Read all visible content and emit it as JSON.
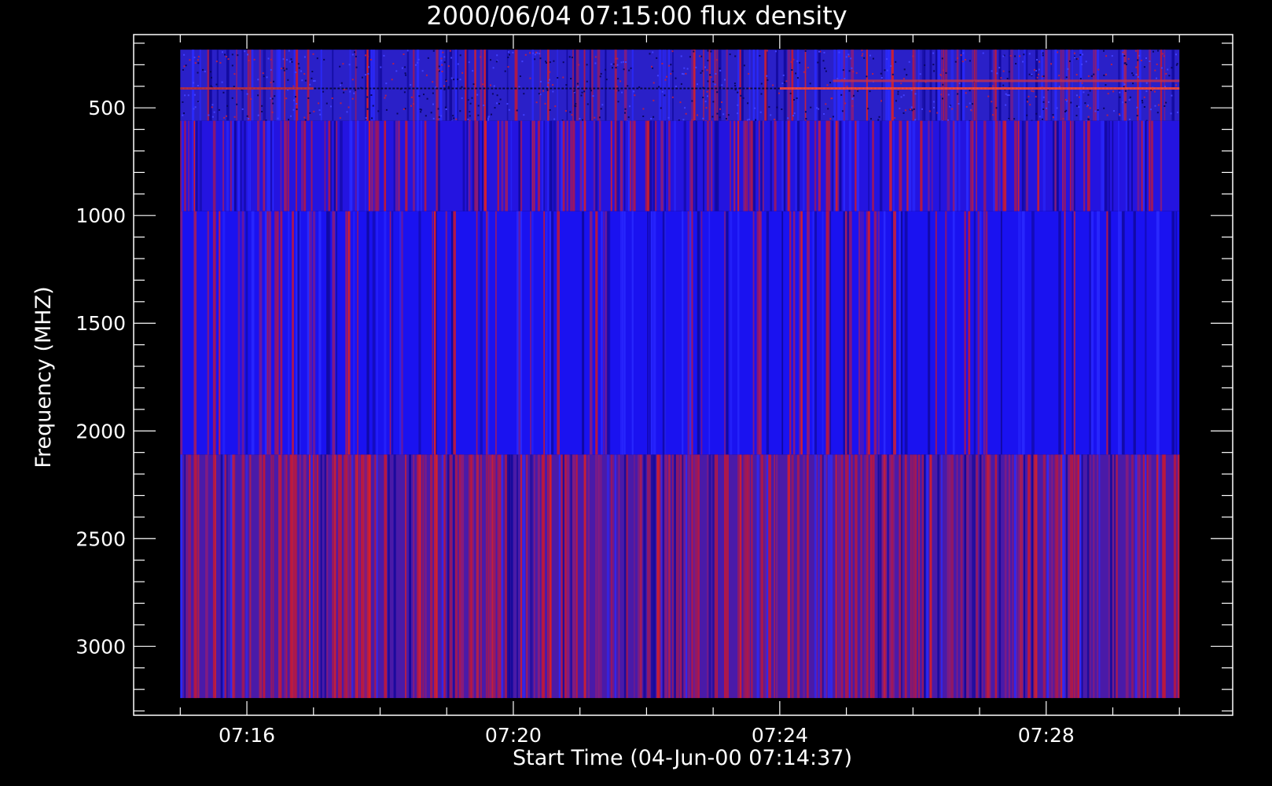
{
  "chart_data": {
    "type": "heatmap",
    "title": "2000/06/04 07:15:00 flux density",
    "xlabel": "Start Time (04-Jun-00 07:14:37)",
    "ylabel": "Frequency (MHZ)",
    "x_ticks": [
      "07:16",
      "07:20",
      "07:24",
      "07:28"
    ],
    "x_tick_minutes": [
      16,
      20,
      24,
      28
    ],
    "y_ticks": [
      "500",
      "1000",
      "1500",
      "2000",
      "2500",
      "3000"
    ],
    "y_tick_values": [
      500,
      1000,
      1500,
      2000,
      2500,
      3000
    ],
    "xlim_minutes": [
      14.3,
      30.8
    ],
    "ylim_mhz": [
      3320,
      160
    ],
    "data_time_range_minutes": [
      15.0,
      30.0
    ],
    "y_inverted": true,
    "frequency_bands": [
      {
        "from_mhz": 230,
        "to_mhz": 560,
        "base_color": "#2a20c8",
        "red_fraction": 0.12,
        "noise": "speckle"
      },
      {
        "from_mhz": 560,
        "to_mhz": 980,
        "base_color": "#2414e0",
        "red_fraction": 0.22,
        "noise": "stripes"
      },
      {
        "from_mhz": 980,
        "to_mhz": 2110,
        "base_color": "#1a12f0",
        "red_fraction": 0.12,
        "noise": "stripes"
      },
      {
        "from_mhz": 2110,
        "to_mhz": 3240,
        "base_color": "#4a1aa8",
        "red_fraction": 0.38,
        "noise": "stripes"
      }
    ],
    "features": [
      {
        "label": "narrowband emission line",
        "freq_mhz": 410,
        "time_from_minutes": 24.0,
        "time_to_minutes": 30.0,
        "color": "#ff4a3a"
      },
      {
        "label": "narrowband emission line",
        "freq_mhz": 410,
        "time_from_minutes": 15.0,
        "time_to_minutes": 17.0,
        "color": "#c03040"
      },
      {
        "label": "narrowband emission line",
        "freq_mhz": 375,
        "time_from_minutes": 24.8,
        "time_to_minutes": 30.0,
        "color": "#c03050"
      }
    ],
    "colors": {
      "background": "#000000",
      "axes": "#ffffff",
      "low": "#0000ff",
      "high": "#ff0000"
    },
    "grid": false,
    "legend": "none"
  }
}
